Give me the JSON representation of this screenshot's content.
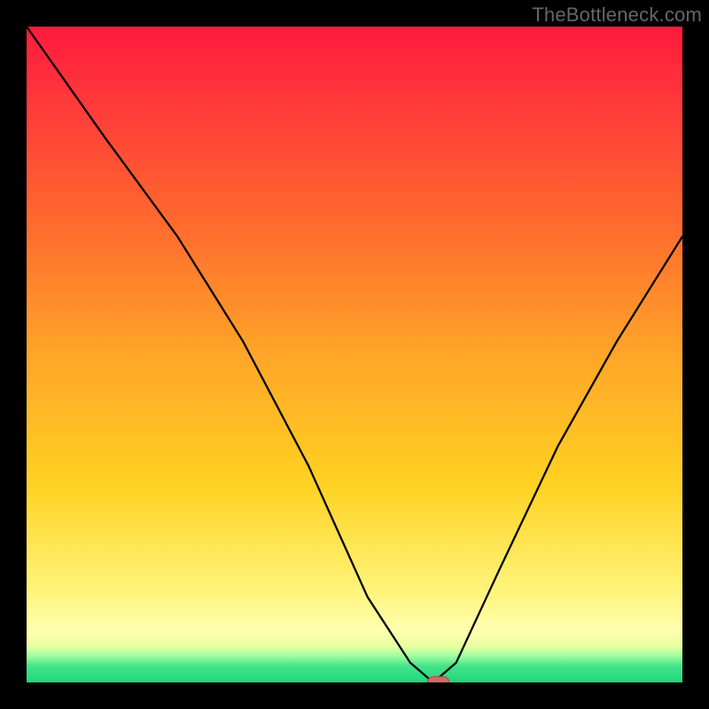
{
  "attribution": "TheBottleneck.com",
  "colors": {
    "page_bg": "#000000",
    "gradient_top": "#ff1a3d",
    "gradient_mid1": "#ffa528",
    "gradient_mid2": "#ffd222",
    "gradient_low": "#ffffb0",
    "gradient_bottom": "#1fd87b",
    "curve": "#000000",
    "marker_fill": "#d06a6a",
    "marker_stroke": "#a94d4d",
    "attribution_text": "#666666"
  },
  "chart_data": {
    "type": "line",
    "title": "",
    "xlabel": "",
    "ylabel": "",
    "xlim": [
      0,
      1
    ],
    "ylim": [
      0,
      1
    ],
    "x": [
      0.0,
      0.12,
      0.23,
      0.33,
      0.43,
      0.52,
      0.585,
      0.62,
      0.655,
      0.72,
      0.81,
      0.9,
      1.0
    ],
    "values": [
      1.0,
      0.83,
      0.68,
      0.52,
      0.33,
      0.13,
      0.03,
      0.0,
      0.03,
      0.17,
      0.36,
      0.52,
      0.68
    ],
    "marker": {
      "x": 0.628,
      "y": 0.0
    },
    "notes": "V-shaped bottleneck curve on vertical red→green gradient; minimum (0%) occurs around x≈0.63 where marker sits; left branch starts at 100% at x=0, right branch rises to ≈68% at x=1."
  }
}
